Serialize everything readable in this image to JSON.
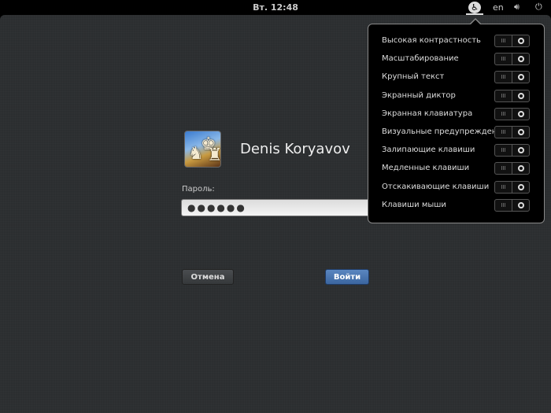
{
  "topbar": {
    "clock": "Вт. 12:48",
    "keyboard_layout": "en",
    "icons": [
      "accessibility-icon",
      "volume-icon",
      "power-icon"
    ]
  },
  "login": {
    "user_name": "Denis Koryavov",
    "password_label": "Пароль:",
    "password_value": "●●●●●●",
    "cancel_label": "Отмена",
    "login_label": "Войти"
  },
  "a11y_menu": {
    "items": [
      {
        "label": "Высокая контрастность",
        "on": false
      },
      {
        "label": "Масштабирование",
        "on": false
      },
      {
        "label": "Крупный текст",
        "on": false
      },
      {
        "label": "Экранный диктор",
        "on": false
      },
      {
        "label": "Экранная клавиатура",
        "on": false
      },
      {
        "label": "Визуальные предупреждения",
        "on": false
      },
      {
        "label": "Залипающие клавиши",
        "on": false
      },
      {
        "label": "Медленные клавиши",
        "on": false
      },
      {
        "label": "Отскакивающие клавиши",
        "on": false
      },
      {
        "label": "Клавиши мыши",
        "on": false
      }
    ],
    "toggle_off_glyph": "III"
  }
}
